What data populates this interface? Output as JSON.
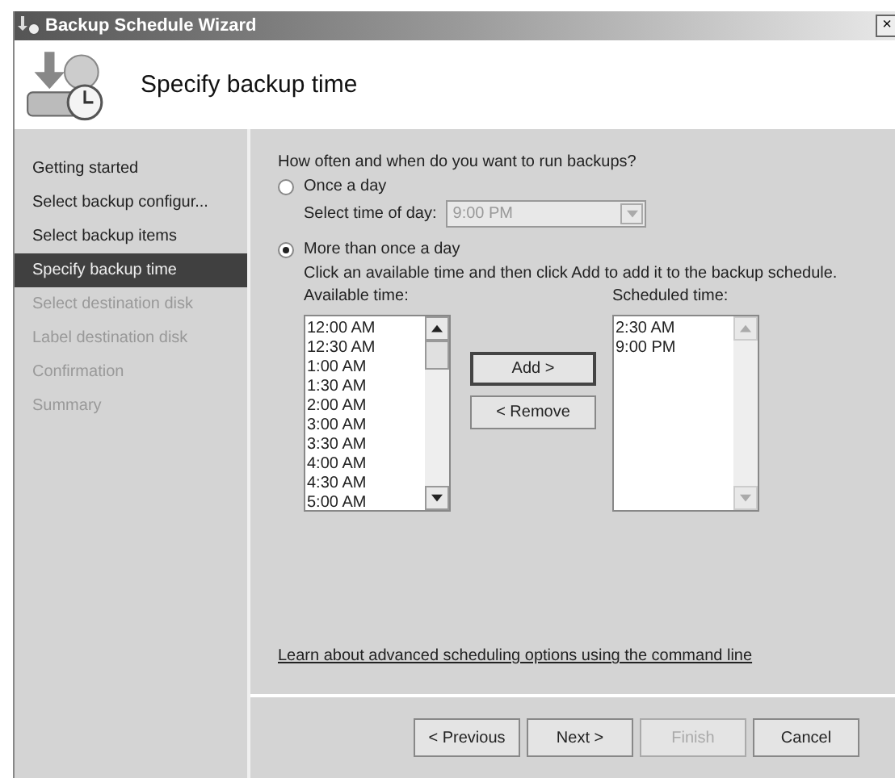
{
  "window": {
    "title": "Backup Schedule Wizard",
    "close": "×"
  },
  "header": {
    "title": "Specify backup time"
  },
  "steps": [
    {
      "label": "Getting started",
      "selected": false,
      "disabled": false
    },
    {
      "label": "Select backup configur...",
      "selected": false,
      "disabled": false
    },
    {
      "label": "Select backup items",
      "selected": false,
      "disabled": false
    },
    {
      "label": "Specify backup time",
      "selected": true,
      "disabled": false
    },
    {
      "label": "Select destination disk",
      "selected": false,
      "disabled": true
    },
    {
      "label": "Label destination disk",
      "selected": false,
      "disabled": true
    },
    {
      "label": "Confirmation",
      "selected": false,
      "disabled": true
    },
    {
      "label": "Summary",
      "selected": false,
      "disabled": true
    }
  ],
  "question": "How often and when do you want to run backups?",
  "options": [
    {
      "label": "Once a day",
      "selected": false
    },
    {
      "label": "More than once a day",
      "selected": true
    }
  ],
  "time_of_day": {
    "label": "Select time of day:",
    "value": "9:00 PM",
    "disabled": true
  },
  "instruction": "Click an available time and then click Add to add it to the backup schedule.",
  "available": {
    "label": "Available time:",
    "items": [
      "12:00 AM",
      "12:30 AM",
      "1:00 AM",
      "1:30 AM",
      "2:00 AM",
      "3:00 AM",
      "3:30 AM",
      "4:00 AM",
      "4:30 AM",
      "5:00 AM"
    ]
  },
  "scheduled": {
    "label": "Scheduled time:",
    "items": [
      "2:30 AM",
      "9:00 PM"
    ]
  },
  "add_button": "Add >",
  "remove_button": "< Remove",
  "link": "Learn about advanced scheduling options using the command line",
  "buttons": [
    {
      "label": "< Previous",
      "disabled": false
    },
    {
      "label": "Next >",
      "disabled": false
    },
    {
      "label": "Finish",
      "disabled": true
    },
    {
      "label": "Cancel",
      "disabled": false
    }
  ]
}
